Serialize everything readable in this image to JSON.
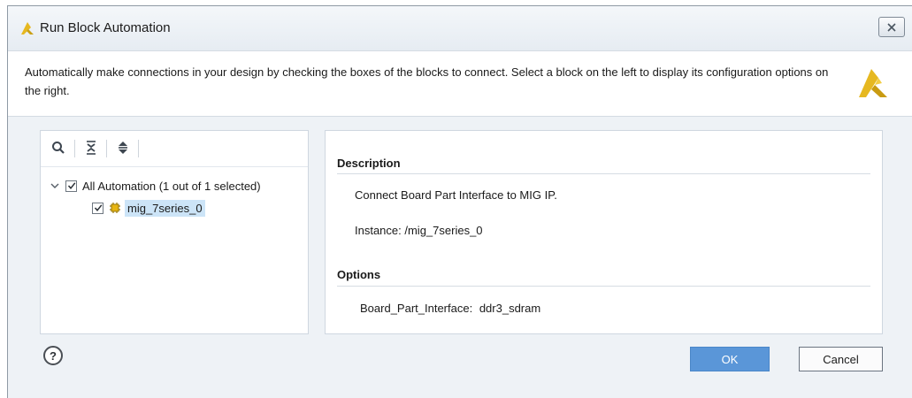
{
  "window": {
    "title": "Run Block Automation",
    "icons": {
      "app": "xilinx-logo-icon",
      "close": "close-icon"
    }
  },
  "banner": {
    "text": "Automatically make connections in your design by checking the boxes of the blocks to connect. Select a block on the left to display its configuration options on the right.",
    "logo": "xilinx-logo-icon"
  },
  "tree": {
    "toolbar": {
      "icons": [
        "search-icon",
        "collapse-all-icon",
        "expand-all-icon"
      ]
    },
    "root": {
      "label": "All Automation (1 out of 1 selected)",
      "checked": true,
      "expanded": true
    },
    "child": {
      "label": "mig_7series_0",
      "checked": true,
      "selected": true,
      "icon": "ip-block-icon"
    }
  },
  "details": {
    "description_heading": "Description",
    "description_text": "Connect Board Part Interface to MIG IP.",
    "instance_label": "Instance: /mig_7series_0",
    "options_heading": "Options",
    "option_name": "Board_Part_Interface:",
    "option_value": "ddr3_sdram"
  },
  "footer": {
    "help_label": "?",
    "ok_label": "OK",
    "cancel_label": "Cancel"
  },
  "colors": {
    "accent": "#5a96d8",
    "selection": "#cce4f7",
    "logo": "#e0b21c"
  }
}
